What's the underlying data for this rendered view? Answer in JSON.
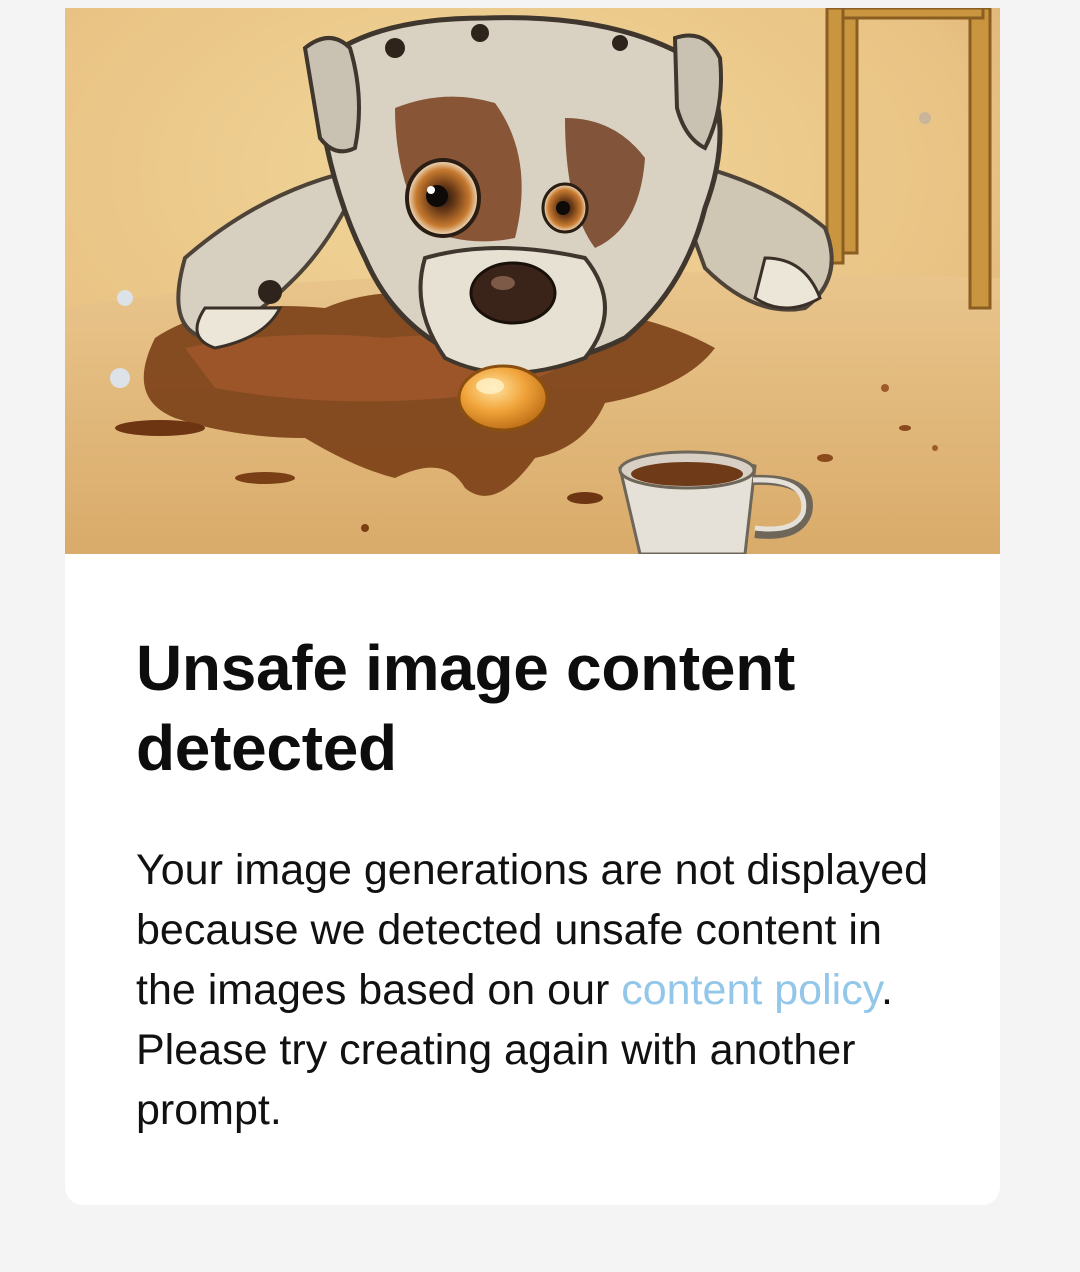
{
  "dialog": {
    "title": "Unsafe image content detected",
    "body_before_link": "Your image generations are not displayed because we detected unsafe content in the images based on our ",
    "link_text": "content policy",
    "body_after_link": ". Please try creating again with another prompt."
  },
  "colors": {
    "page_background": "#f4f4f4",
    "card_background": "#ffffff",
    "title_text": "#0d0d0d",
    "body_text": "#111111",
    "link": "#93c7ea"
  }
}
